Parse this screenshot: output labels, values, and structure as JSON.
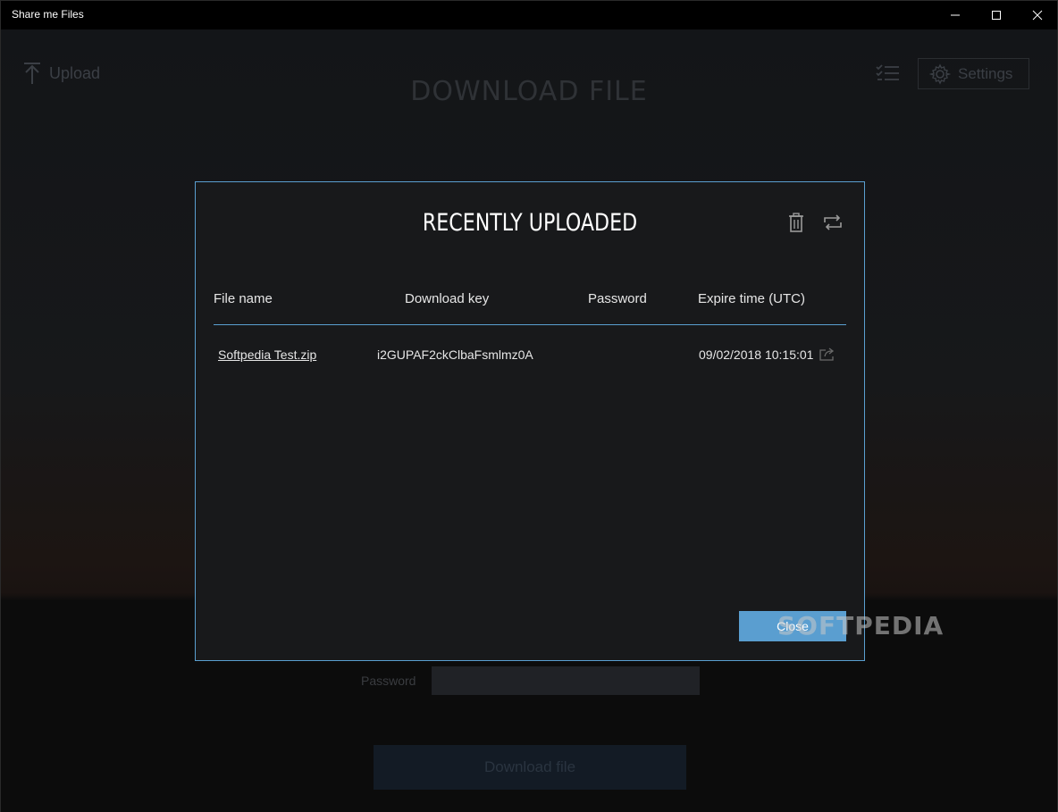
{
  "window": {
    "title": "Share me Files"
  },
  "background": {
    "upload_label": "Upload",
    "heading": "DOWNLOAD FILE",
    "settings_label": "Settings",
    "password_label": "Password",
    "download_button_label": "Download file"
  },
  "modal": {
    "title": "RECENTLY UPLOADED",
    "columns": [
      "File name",
      "Download key",
      "Password",
      "Expire time (UTC)"
    ],
    "rows": [
      {
        "file_name": "Softpedia Test.zip",
        "download_key": "i2GUPAF2ckClbaFsmlmz0A",
        "password": "",
        "expire_time": "09/02/2018 10:15:01"
      }
    ],
    "close_label": "Close"
  },
  "watermark": "SOFTPEDIA",
  "colors": {
    "accent": "#5a9fd0",
    "modal_bg": "#18191b",
    "titlebar_bg": "#000000"
  },
  "icons": {
    "upload": "arrow-up-icon",
    "list": "checklist-icon",
    "settings": "gear-icon",
    "trash": "trash-icon",
    "refresh": "repeat-icon",
    "share": "share-icon"
  }
}
